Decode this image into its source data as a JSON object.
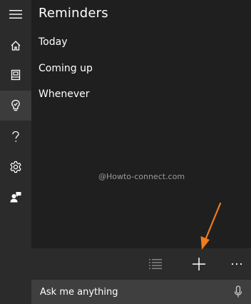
{
  "header": {
    "title": "Reminders"
  },
  "nav": {
    "items": [
      {
        "label": "Today"
      },
      {
        "label": "Coming up"
      },
      {
        "label": "Whenever"
      }
    ]
  },
  "watermark": "@Howto-connect.com",
  "search": {
    "placeholder": "Ask me anything"
  },
  "rail": {
    "icons": [
      "hamburger-menu-icon",
      "home-icon",
      "notebook-icon",
      "lightbulb-icon",
      "help-icon",
      "gear-icon",
      "feedback-icon"
    ],
    "active": "lightbulb-icon"
  },
  "commandbar": {
    "icons": [
      "list-view-icon",
      "add-icon",
      "more-icon"
    ]
  },
  "colors": {
    "background": "#1f1f1f",
    "rail": "#2b2b2b",
    "rail_active": "#3c3c3c",
    "search": "#3f3f3f",
    "annotation_arrow": "#f07d1a"
  }
}
